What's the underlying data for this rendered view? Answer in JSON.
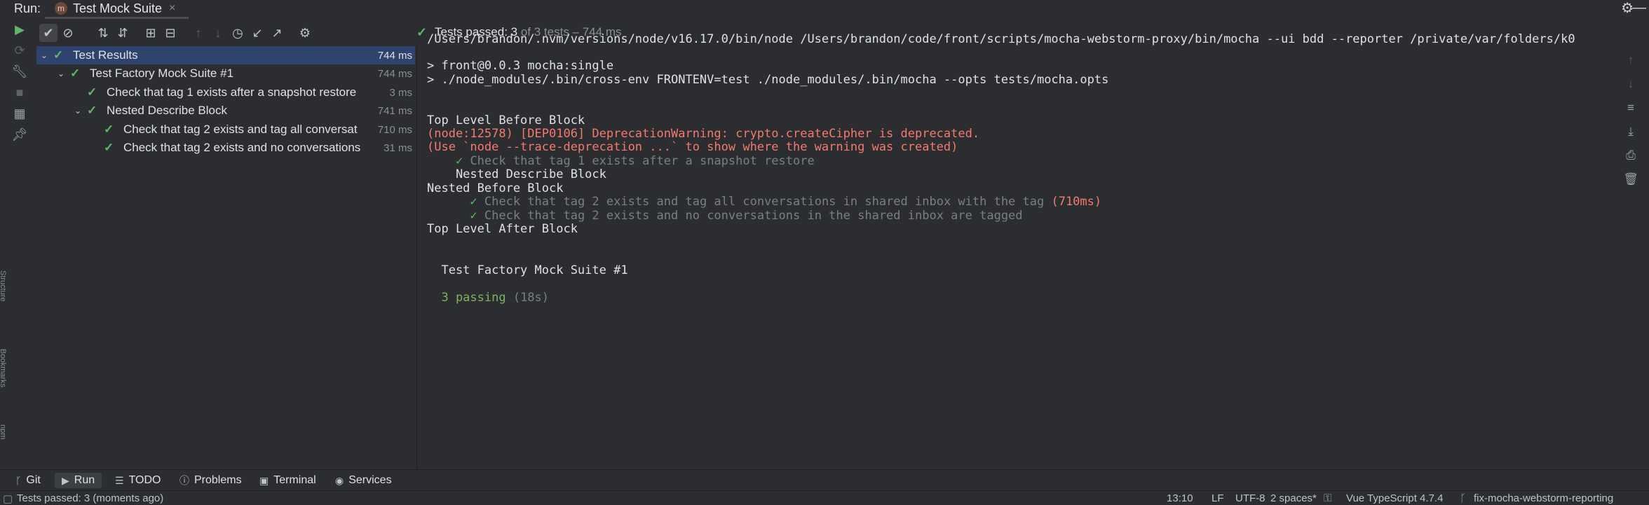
{
  "header": {
    "run_label": "Run:",
    "tab_badge": "m",
    "tab_title": "Test Mock Suite",
    "close_glyph": "×",
    "settings_icon": "gear-icon",
    "minimize_icon": "minimize-icon"
  },
  "status": {
    "passed": "Tests passed: 3",
    "rest": " of 3 tests – 744 ms"
  },
  "tree": {
    "rows": [
      {
        "label": "Test Results",
        "duration": "744 ms"
      },
      {
        "label": "Test Factory Mock Suite #1",
        "duration": "744 ms"
      },
      {
        "label": "Check that tag 1 exists after a snapshot restore",
        "duration": "3 ms"
      },
      {
        "label": "Nested Describe Block",
        "duration": "741 ms"
      },
      {
        "label": "Check that tag 2 exists and tag all conversat",
        "duration": "710 ms"
      },
      {
        "label": "Check that tag 2 exists and no conversations",
        "duration": "31 ms"
      }
    ]
  },
  "console": {
    "line1": "/Users/brandon/.nvm/versions/node/v16.17.0/bin/node /Users/brandon/code/front/scripts/mocha-webstorm-proxy/bin/mocha --ui bdd --reporter /private/var/folders/k0",
    "line2": "> front@0.0.3 mocha:single",
    "line3": "> ./node_modules/.bin/cross-env FRONTENV=test ./node_modules/.bin/mocha --opts tests/mocha.opts",
    "line4": "Top Level Before Block",
    "line5": "(node:12578) [DEP0106] DeprecationWarning: crypto.createCipher is deprecated.",
    "line6": "(Use `node --trace-deprecation ...` to show where the warning was created)",
    "line7_check": "✓",
    "line7_text": " Check that tag 1 exists after a snapshot restore",
    "line8": "    Nested Describe Block",
    "line9": "Nested Before Block",
    "line10_check": "✓",
    "line10_text": " Check that tag 2 exists and tag all conversations in shared inbox with the tag ",
    "line10_time": "(710ms)",
    "line11_check": "✓",
    "line11_text": " Check that tag 2 exists and no conversations in the shared inbox are tagged",
    "line12": "Top Level After Block",
    "line13": "  Test Factory Mock Suite #1",
    "line14_pass": "  3 passing",
    "line14_time": " (18s)"
  },
  "bottom_tabs": {
    "git": "Git",
    "run": "Run",
    "todo": "TODO",
    "problems": "Problems",
    "terminal": "Terminal",
    "services": "Services"
  },
  "statusbar": {
    "message": "Tests passed: 3 (moments ago)",
    "position": "13:10",
    "line_sep": "LF",
    "encoding": "UTF-8",
    "indent": "2 spaces*",
    "language": "Vue TypeScript 4.7.4",
    "branch": "fix-mocha-webstorm-reporting"
  },
  "side_labels": {
    "structure": "Structure",
    "bookmarks": "Bookmarks",
    "npm": "npm"
  },
  "colors": {
    "background": "#2b2d30",
    "selection": "#2e436e",
    "success": "#5fb868",
    "error": "#f27b6d"
  }
}
